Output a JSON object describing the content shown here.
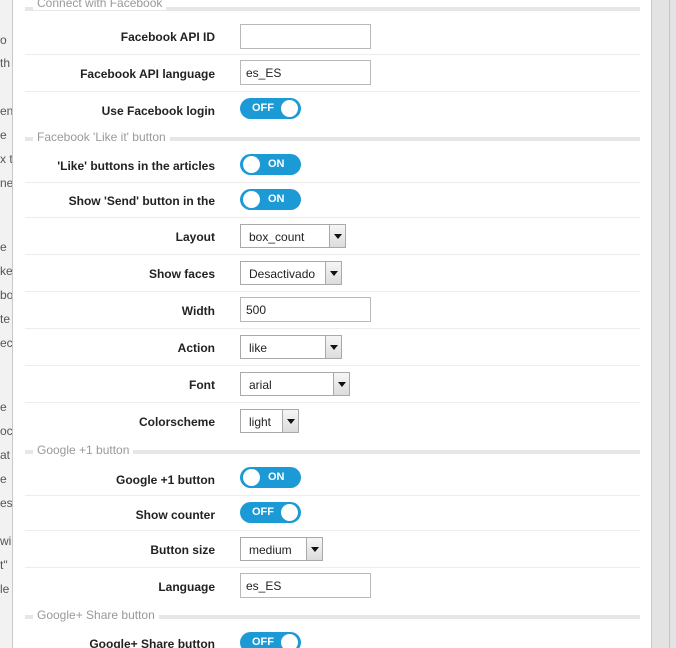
{
  "background_fragments": [
    "o",
    "th",
    "en",
    "e",
    "x t",
    "ne",
    "e",
    "ke",
    "bo",
    "te",
    "ec",
    "e",
    "oc",
    "at",
    "e",
    "es",
    "wi",
    "t\"",
    "le"
  ],
  "sections": {
    "facebook_connect": "Connect with Facebook",
    "facebook_like": "Facebook 'Like it' button",
    "google_plus_one": "Google +1 button",
    "google_share": "Google+ Share button"
  },
  "fields": {
    "facebook_api_id": {
      "label": "Facebook API ID",
      "value": ""
    },
    "facebook_api_language": {
      "label": "Facebook API language",
      "value": "es_ES"
    },
    "use_facebook_login": {
      "label": "Use Facebook login",
      "state": "OFF"
    },
    "like_buttons_articles": {
      "label": "'Like' buttons in the articles",
      "state": "ON"
    },
    "show_send_button": {
      "label": "Show 'Send' button in the",
      "state": "ON"
    },
    "layout": {
      "label": "Layout",
      "value": "box_count"
    },
    "show_faces": {
      "label": "Show faces",
      "value": "Desactivado"
    },
    "width": {
      "label": "Width",
      "value": "500"
    },
    "action": {
      "label": "Action",
      "value": "like"
    },
    "font": {
      "label": "Font",
      "value": "arial"
    },
    "colorscheme": {
      "label": "Colorscheme",
      "value": "light"
    },
    "google_plus_one_button": {
      "label": "Google +1 button",
      "state": "ON"
    },
    "show_counter": {
      "label": "Show counter",
      "state": "OFF"
    },
    "button_size": {
      "label": "Button size",
      "value": "medium"
    },
    "language": {
      "label": "Language",
      "value": "es_ES"
    },
    "google_share_button": {
      "label": "Google+ Share button",
      "state": "OFF"
    }
  },
  "colors": {
    "toggle_bg": "#1c9ad6",
    "section_text": "#999999",
    "label_text": "#222222"
  }
}
